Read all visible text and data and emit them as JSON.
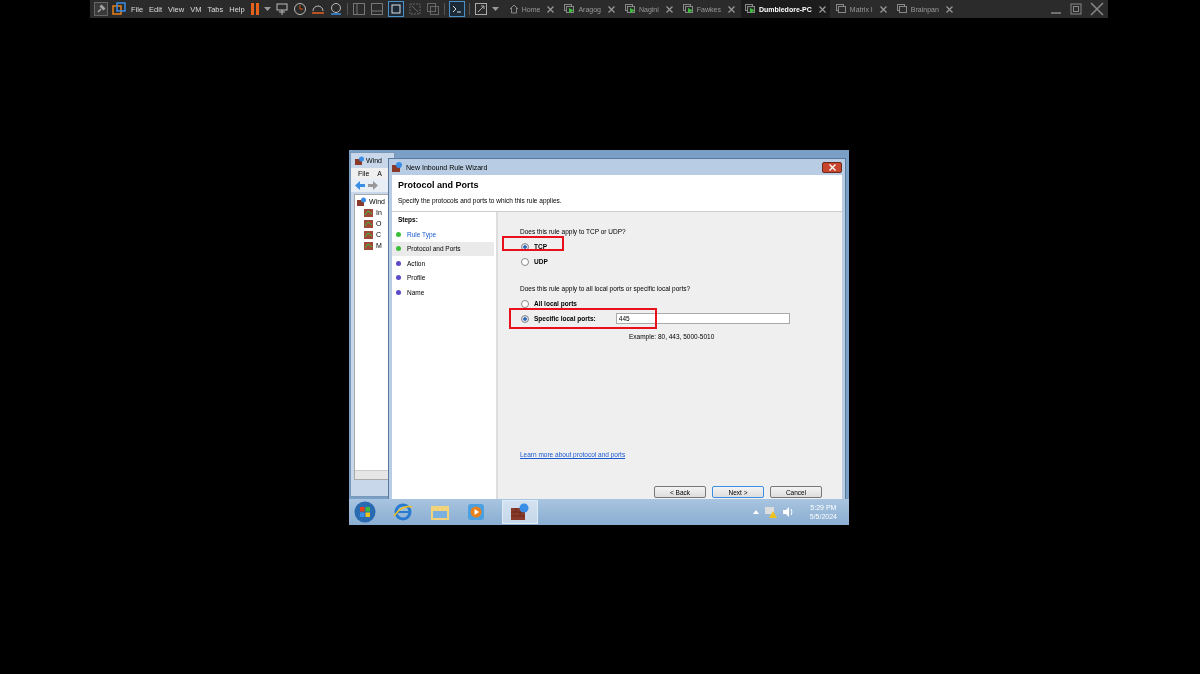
{
  "vm_toolbar": {
    "menus": [
      "File",
      "Edit",
      "View",
      "VM",
      "Tabs",
      "Help"
    ],
    "tabs": [
      {
        "label": "Home",
        "kind": "home",
        "selected": false
      },
      {
        "label": "Aragog",
        "kind": "vm",
        "running": true,
        "selected": false
      },
      {
        "label": "Nagini",
        "kind": "vm",
        "running": true,
        "selected": false
      },
      {
        "label": "Fawkes",
        "kind": "vm",
        "running": true,
        "selected": false
      },
      {
        "label": "Dumbledore-PC",
        "kind": "vm",
        "running": true,
        "selected": true
      },
      {
        "label": "Matrix I",
        "kind": "vm",
        "running": false,
        "selected": false
      },
      {
        "label": "Brainpan",
        "kind": "vm",
        "running": false,
        "selected": false
      }
    ]
  },
  "background_window": {
    "title": "Wind",
    "menus": [
      "File",
      "A"
    ],
    "tree": [
      {
        "label": "Wind",
        "children": [
          {
            "label": "In"
          },
          {
            "label": "O"
          },
          {
            "label": "C"
          },
          {
            "label": "M"
          }
        ]
      }
    ]
  },
  "dialog": {
    "title": "New Inbound Rule Wizard",
    "heading": "Protocol and Ports",
    "subtitle": "Specify the protocols and ports to which this rule applies.",
    "steps_label": "Steps:",
    "steps": [
      {
        "label": "Rule Type",
        "completed": true,
        "selected": false
      },
      {
        "label": "Protocol and Ports",
        "completed": true,
        "selected": true
      },
      {
        "label": "Action",
        "completed": false,
        "selected": false
      },
      {
        "label": "Profile",
        "completed": false,
        "selected": false
      },
      {
        "label": "Name",
        "completed": false,
        "selected": false
      }
    ],
    "protocol_question": "Does this rule apply to TCP or UDP?",
    "protocol_options": [
      {
        "label": "TCP",
        "selected": true
      },
      {
        "label": "UDP",
        "selected": false
      }
    ],
    "ports_question": "Does this rule apply to all local ports or specific local ports?",
    "port_options": [
      {
        "label": "All local ports",
        "selected": false
      },
      {
        "label": "Specific local ports:",
        "selected": true
      }
    ],
    "ports_field": {
      "value": "445"
    },
    "ports_example": "Example: 80, 443, 5000-5010",
    "learn_more_link": "Learn more about protocol and ports",
    "buttons": [
      "< Back",
      "Next >",
      "Cancel"
    ]
  },
  "taskbar": {
    "time": "5:29 PM",
    "date": "5/5/2024"
  }
}
